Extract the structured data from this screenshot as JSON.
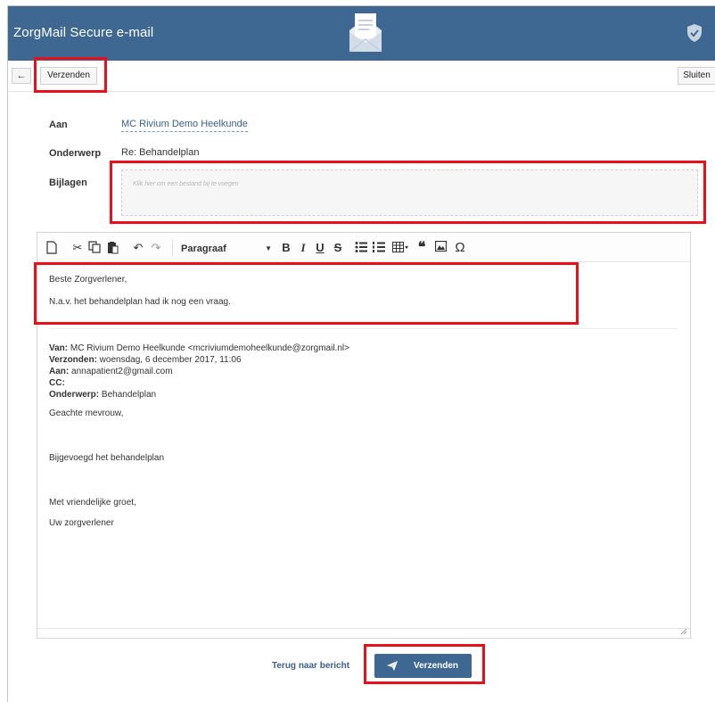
{
  "app": {
    "title": "ZorgMail Secure e-mail",
    "brand_color": "#3e6791",
    "header_icons": [
      "envelope-icon",
      "shield-icon"
    ]
  },
  "toolbar": {
    "back_label": "←",
    "send_label": "Verzenden",
    "close_label": "Sluiten"
  },
  "form": {
    "to_label": "Aan",
    "to_value": "MC Rivium Demo Heelkunde",
    "subject_label": "Onderwerp",
    "subject_value": "Re: Behandelplan",
    "attachments_label": "Bijlagen",
    "attachments_placeholder": "Klik hier om een bestand bij te voegen"
  },
  "editor": {
    "paragraph_format": "Paragraaf",
    "toolbar_icons": [
      "new-document-icon",
      "cut-icon",
      "copy-icon",
      "paste-icon",
      "undo-icon",
      "redo-icon",
      "paragraph-format-select",
      "bold-icon",
      "italic-icon",
      "underline-icon",
      "strikethrough-icon",
      "bullet-list-icon",
      "numbered-list-icon",
      "table-icon",
      "blockquote-icon",
      "image-icon",
      "special-character-icon"
    ],
    "reply_lines": [
      "Beste Zorgverlener,",
      "N.a.v. het behandelplan had ik nog een vraag."
    ],
    "quoted": {
      "from_label": "Van:",
      "from_value": " MC Rivium Demo Heelkunde <mcriviumdemoheelkunde@zorgmail.nl>",
      "sent_label": "Verzonden:",
      "sent_value": " woensdag, 6 december 2017, 11:06",
      "to_label": "Aan:",
      "to_value": " annapatient2@gmail.com",
      "cc_label": "CC:",
      "cc_value": "",
      "subject_label": "Onderwerp:",
      "subject_value": " Behandelplan",
      "body_lines": [
        "Geachte mevrouw,",
        "Bijgevoegd het behandelplan",
        "Met vriendelijke groet,",
        "Uw zorgverlener"
      ]
    }
  },
  "footer": {
    "back_link": "Terug naar bericht",
    "send_label": "Verzenden"
  },
  "annotation": {
    "highlight_color": "#e8101a"
  }
}
